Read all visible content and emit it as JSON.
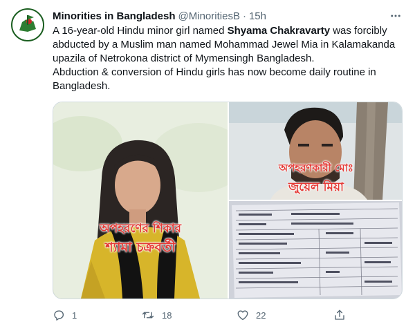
{
  "tweet": {
    "author": {
      "name": "Minorities in Bangladesh",
      "handle": "@MinoritiesB",
      "separator": "·",
      "time": "15h"
    },
    "text": {
      "part1": "A 16-year-old Hindu minor girl named ",
      "highlight": "Shyama Chakravarty",
      "part2": " was forcibly abducted by a Muslim man named Mohammad Jewel Mia in  Kalamakanda upazila of Netrokona district of Mymensingh Bangladesh.",
      "line2": "Abduction & conversion of Hindu girls has now become daily routine in Bangladesh."
    },
    "media": {
      "left_caption_line1": "অপহরণের শিকার",
      "left_caption_line2": "শ্যামা চক্রবর্তী",
      "right_caption_line1": "অপহরণকারী মোঃ",
      "right_caption_line2": "জুয়েল মিয়া"
    },
    "actions": {
      "reply_count": "1",
      "retweet_count": "18",
      "like_count": "22"
    },
    "icons": {
      "more": "more-horizontal-icon",
      "reply": "reply-icon",
      "retweet": "retweet-icon",
      "like": "heart-icon",
      "share": "share-icon"
    },
    "colors": {
      "secondary_text": "#536471",
      "overlay_red": "#e53935",
      "border": "#cfd9de"
    }
  }
}
